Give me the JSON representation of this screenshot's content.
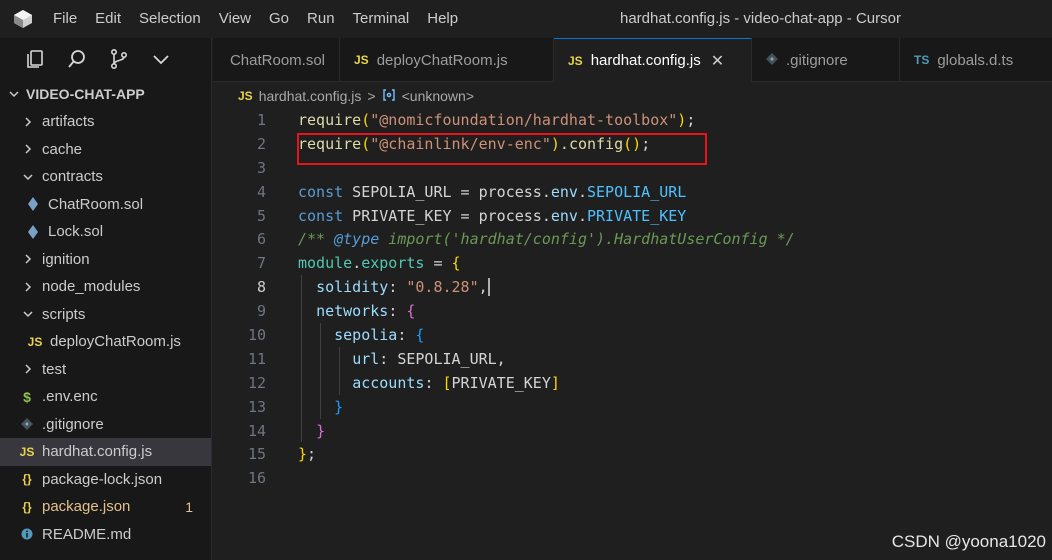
{
  "window": {
    "title": "hardhat.config.js - video-chat-app - Cursor",
    "menu": [
      "File",
      "Edit",
      "Selection",
      "View",
      "Go",
      "Run",
      "Terminal",
      "Help"
    ]
  },
  "explorer": {
    "root": "VIDEO-CHAT-APP",
    "items": [
      {
        "label": "artifacts",
        "type": "folder",
        "expanded": false
      },
      {
        "label": "cache",
        "type": "folder",
        "expanded": false
      },
      {
        "label": "contracts",
        "type": "folder",
        "expanded": true
      },
      {
        "label": "ChatRoom.sol",
        "type": "sol"
      },
      {
        "label": "Lock.sol",
        "type": "sol"
      },
      {
        "label": "ignition",
        "type": "folder",
        "expanded": false
      },
      {
        "label": "node_modules",
        "type": "folder",
        "expanded": false
      },
      {
        "label": "scripts",
        "type": "folder",
        "expanded": true
      },
      {
        "label": "deployChatRoom.js",
        "type": "js"
      },
      {
        "label": "test",
        "type": "folder",
        "expanded": false
      },
      {
        "label": ".env.enc",
        "type": "env"
      },
      {
        "label": ".gitignore",
        "type": "git"
      },
      {
        "label": "hardhat.config.js",
        "type": "js",
        "selected": true
      },
      {
        "label": "package-lock.json",
        "type": "json"
      },
      {
        "label": "package.json",
        "type": "json",
        "modified": true,
        "badge": "1"
      },
      {
        "label": "README.md",
        "type": "md"
      }
    ]
  },
  "tabs": [
    {
      "label": "ChatRoom.sol",
      "icon": "sol-icon",
      "partial": true
    },
    {
      "label": "deployChatRoom.js",
      "icon": "JS"
    },
    {
      "label": "hardhat.config.js",
      "icon": "JS",
      "active": true
    },
    {
      "label": ".gitignore",
      "icon": "git-icon"
    },
    {
      "label": "globals.d.ts",
      "icon": "TS"
    }
  ],
  "breadcrumb": {
    "file": "hardhat.config.js",
    "separator": ">",
    "symbol": "<unknown>"
  },
  "editor": {
    "active_line": 8,
    "line_numbers": [
      "1",
      "2",
      "3",
      "4",
      "5",
      "6",
      "7",
      "8",
      "9",
      "10",
      "11",
      "12",
      "13",
      "14",
      "15",
      "16"
    ]
  },
  "watermark": "CSDN @yoona1020",
  "colors": {
    "accent": "#0078d4",
    "highlight_box": "#e8141a",
    "modified": "#e2c08d"
  }
}
